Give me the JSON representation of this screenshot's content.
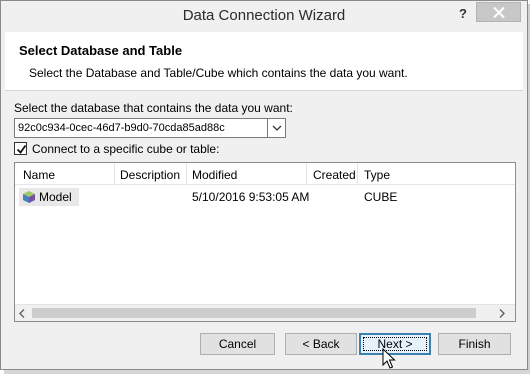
{
  "window": {
    "title": "Data Connection Wizard",
    "help_label": "?"
  },
  "header": {
    "title": "Select Database and Table",
    "subtitle": "Select the Database and Table/Cube which contains the data you want."
  },
  "database": {
    "label": "Select the database that contains the data you want:",
    "value": "92c0c934-0cec-46d7-b9d0-70cda85ad88c"
  },
  "cube_checkbox": {
    "label": "Connect to a specific cube or table:",
    "checked": true
  },
  "table": {
    "columns": [
      "Name",
      "Description",
      "Modified",
      "Created",
      "Type"
    ],
    "rows": [
      {
        "name": "Model",
        "description": "",
        "modified": "5/10/2016 9:53:05 AM",
        "created": "",
        "type": "CUBE"
      }
    ]
  },
  "buttons": {
    "cancel": "Cancel",
    "back": "< Back",
    "next": "Next >",
    "finish": "Finish"
  },
  "colors": {
    "accent": "#3c7fb1",
    "window_bg": "#f0f0f0"
  }
}
